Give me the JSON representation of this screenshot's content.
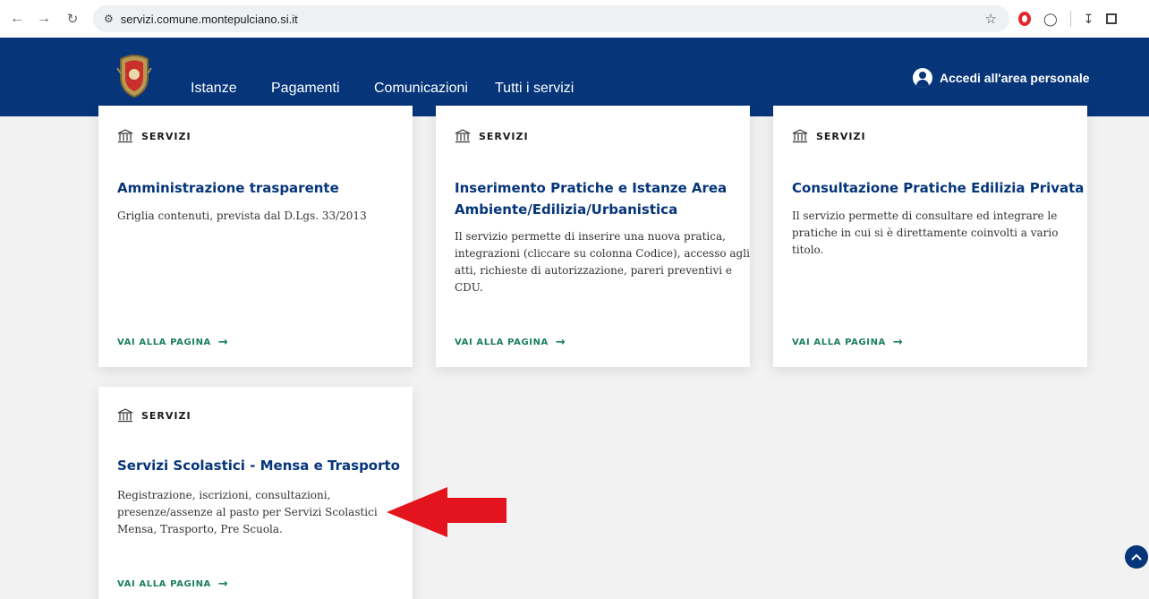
{
  "browser": {
    "url": "servizi.comune.montepulciano.si.it"
  },
  "header": {
    "nav": [
      "Istanze",
      "Pagamenti",
      "Comunicazioni",
      "Tutti i servizi"
    ],
    "login_label": "Accedi all'area personale",
    "bg_color": "#06357a"
  },
  "cards": [
    {
      "category": "SERVIZI",
      "title": "Amministrazione trasparente",
      "description": [
        "Griglia contenuti, prevista dal D.Lgs. 33/2013"
      ],
      "link": "VAI ALLA PAGINA"
    },
    {
      "category": "SERVIZI",
      "title": [
        "Inserimento Pratiche e Istanze Area",
        "Ambiente/Edilizia/Urbanistica"
      ],
      "description": [
        "Il servizio permette di inserire una nuova pratica,",
        "integrazioni (cliccare su colonna Codice), accesso agli",
        "atti, richieste di autorizzazione, pareri preventivi e",
        "CDU."
      ],
      "link": "VAI ALLA PAGINA"
    },
    {
      "category": "SERVIZI",
      "title": "Consultazione Pratiche Edilizia Privata",
      "description": [
        "Il servizio permette di consultare ed integrare le",
        "pratiche in cui si è direttamente coinvolti a vario",
        "titolo."
      ],
      "link": "VAI ALLA PAGINA"
    },
    {
      "category": "SERVIZI",
      "title": "Servizi Scolastici - Mensa e Trasporto",
      "description": [
        "Registrazione, iscrizioni, consultazioni,",
        "presenze/assenze al pasto per Servizi Scolastici",
        "Mensa, Trasporto, Pre Scuola."
      ],
      "link": "VAI ALLA PAGINA"
    }
  ],
  "icons": {
    "category": "bank-icon",
    "link": "arrow-right-icon",
    "annotation": "red-arrow-icon",
    "back_to_top": "chevron-up-icon"
  },
  "colors": {
    "accent": "#06357a",
    "link": "#1a7f5a",
    "annotation": "#e3141d"
  }
}
